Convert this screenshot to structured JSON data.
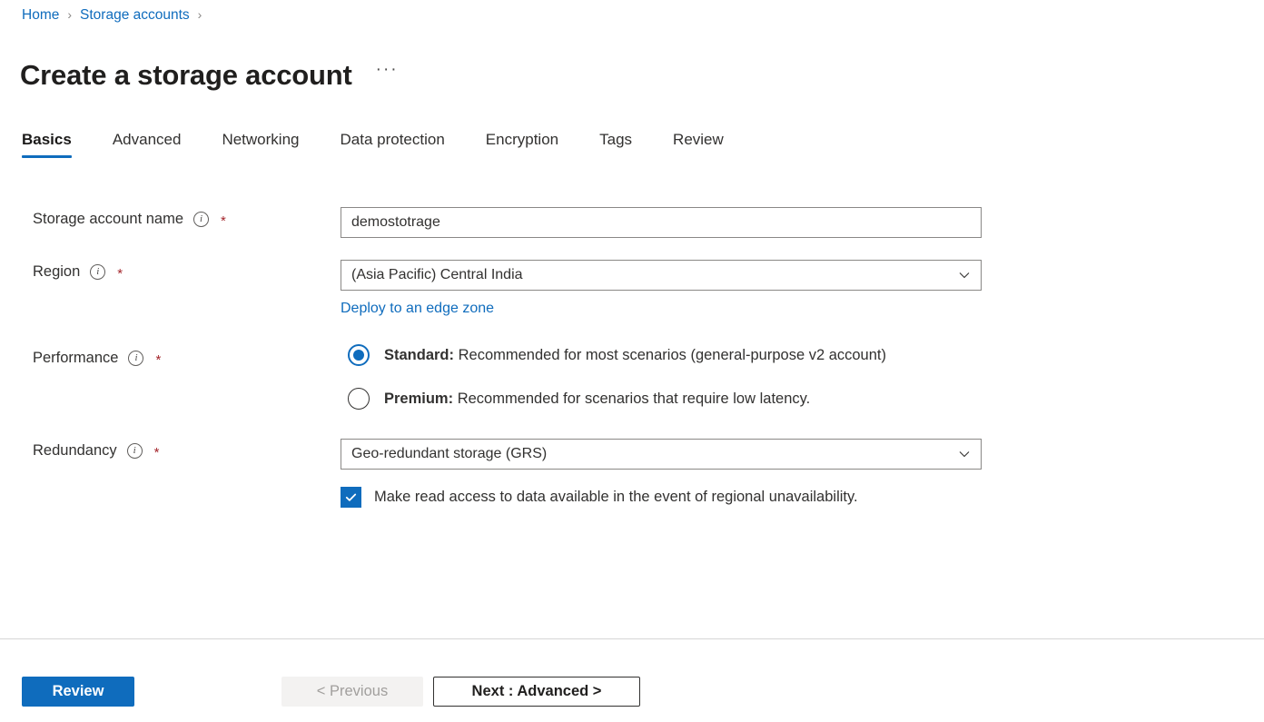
{
  "breadcrumb": {
    "items": [
      {
        "label": "Home"
      },
      {
        "label": "Storage accounts"
      }
    ],
    "separator": "›"
  },
  "header": {
    "title": "Create a storage account",
    "more_menu": "···"
  },
  "tabs": [
    {
      "label": "Basics",
      "active": true
    },
    {
      "label": "Advanced",
      "active": false
    },
    {
      "label": "Networking",
      "active": false
    },
    {
      "label": "Data protection",
      "active": false
    },
    {
      "label": "Encryption",
      "active": false
    },
    {
      "label": "Tags",
      "active": false
    },
    {
      "label": "Review",
      "active": false
    }
  ],
  "form": {
    "storage_account_name": {
      "label": "Storage account name",
      "required_marker": "*",
      "value": "demostotrage",
      "placeholder": ""
    },
    "region": {
      "label": "Region",
      "required_marker": "*",
      "value": "(Asia Pacific) Central India",
      "edge_zone_link": "Deploy to an edge zone"
    },
    "performance": {
      "label": "Performance",
      "required_marker": "*",
      "options": [
        {
          "name_bold": "Standard:",
          "description": " Recommended for most scenarios (general-purpose v2 account)",
          "selected": true
        },
        {
          "name_bold": "Premium:",
          "description": " Recommended for scenarios that require low latency.",
          "selected": false
        }
      ]
    },
    "redundancy": {
      "label": "Redundancy",
      "required_marker": "*",
      "value": "Geo-redundant storage (GRS)",
      "checkbox_label": "Make read access to data available in the event of regional unavailability.",
      "checkbox_checked": true
    }
  },
  "footer": {
    "review_label": "Review",
    "previous_label": "< Previous",
    "next_label": "Next : Advanced >"
  },
  "colors": {
    "accent": "#0f6cbd",
    "link": "#0f6cbd",
    "required": "#a4262c",
    "text": "#323130",
    "disabled_text": "#a19f9d",
    "disabled_bg": "#f3f2f1",
    "border": "#8a8886"
  }
}
